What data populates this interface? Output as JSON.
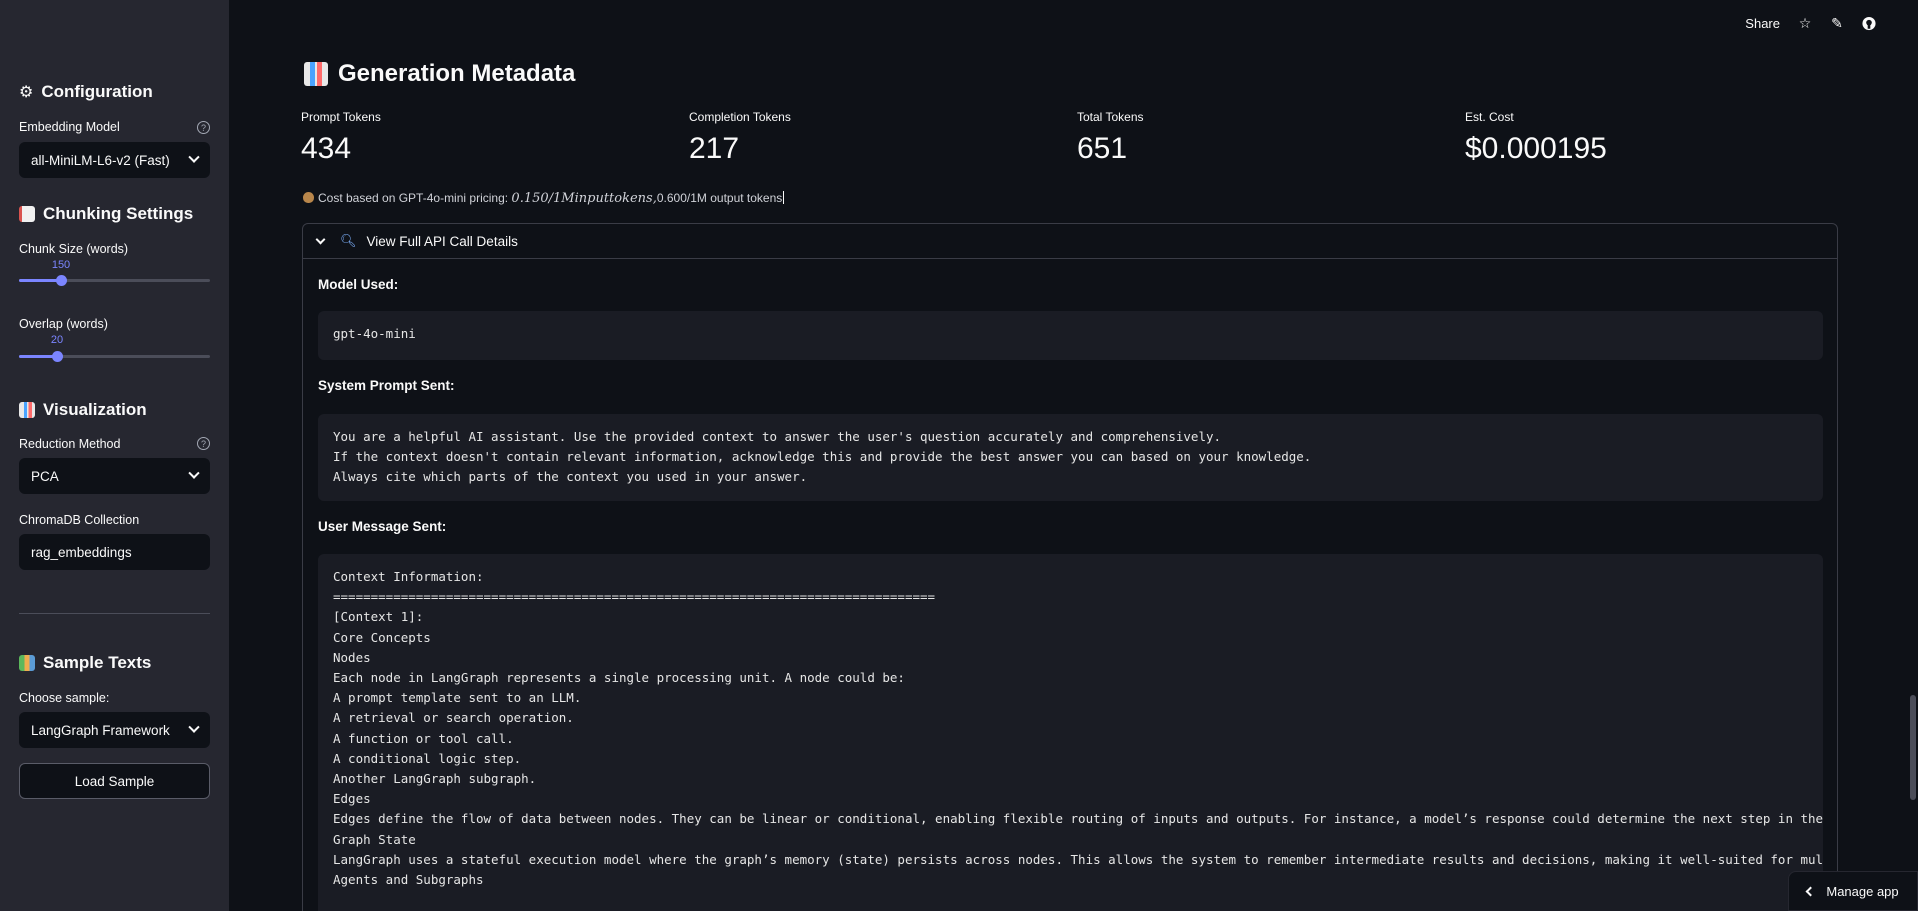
{
  "sidebar": {
    "configuration_title": "Configuration",
    "embedding_model_label": "Embedding Model",
    "embedding_model_value": "all-MiniLM-L6-v2 (Fast)",
    "chunking_title": "Chunking Settings",
    "chunk_size_label": "Chunk Size (words)",
    "chunk_size_value": "150",
    "chunk_size_fraction": 0.22,
    "overlap_label": "Overlap (words)",
    "overlap_value": "20",
    "overlap_fraction": 0.2,
    "visualization_title": "Visualization",
    "reduction_label": "Reduction Method",
    "reduction_value": "PCA",
    "collection_label": "ChromaDB Collection",
    "collection_value": "rag_embeddings",
    "samples_title": "Sample Texts",
    "choose_sample_label": "Choose sample:",
    "choose_sample_value": "LangGraph Framework",
    "load_sample_button": "Load Sample",
    "help_glyph": "?"
  },
  "topbar": {
    "share_label": "Share",
    "icons": [
      "star-icon",
      "edit-icon",
      "github-icon"
    ]
  },
  "main": {
    "title": "Generation Metadata",
    "metrics": [
      {
        "label": "Prompt Tokens",
        "value": "434"
      },
      {
        "label": "Completion Tokens",
        "value": "217"
      },
      {
        "label": "Total Tokens",
        "value": "651"
      },
      {
        "label": "Est. Cost",
        "value": "$0.000195"
      }
    ],
    "cost_note_prefix": "Cost based on GPT-4o-mini pricing: ",
    "cost_note_math": "0.150/1Minputtokens,",
    "cost_note_suffix": "0.600/1M output tokens",
    "expander_title": "View Full API Call Details",
    "model_used_label": "Model Used:",
    "model_used_value": "gpt-4o-mini",
    "system_prompt_label": "System Prompt Sent:",
    "system_prompt_value": "You are a helpful AI assistant. Use the provided context to answer the user's question accurately and comprehensively.\nIf the context doesn't contain relevant information, acknowledge this and provide the best answer you can based on your knowledge.\nAlways cite which parts of the context you used in your answer.",
    "user_message_label": "User Message Sent:",
    "user_message_value": "Context Information:\n================================================================================\n[Context 1]:\nCore Concepts\nNodes\nEach node in LangGraph represents a single processing unit. A node could be:\nA prompt template sent to an LLM.\nA retrieval or search operation.\nA function or tool call.\nA conditional logic step.\nAnother LangGraph subgraph.\nEdges\nEdges define the flow of data between nodes. They can be linear or conditional, enabling flexible routing of inputs and outputs. For instance, a model’s response could determine the next step in the\nGraph State\nLangGraph uses a stateful execution model where the graph’s memory (state) persists across nodes. This allows the system to remember intermediate results and decisions, making it well-suited for mul\nAgents and Subgraphs"
  },
  "footer": {
    "manage_app_label": "Manage app"
  },
  "colors": {
    "background": "#0e1117",
    "sidebar": "#262730",
    "accent": "#7b85ff"
  }
}
